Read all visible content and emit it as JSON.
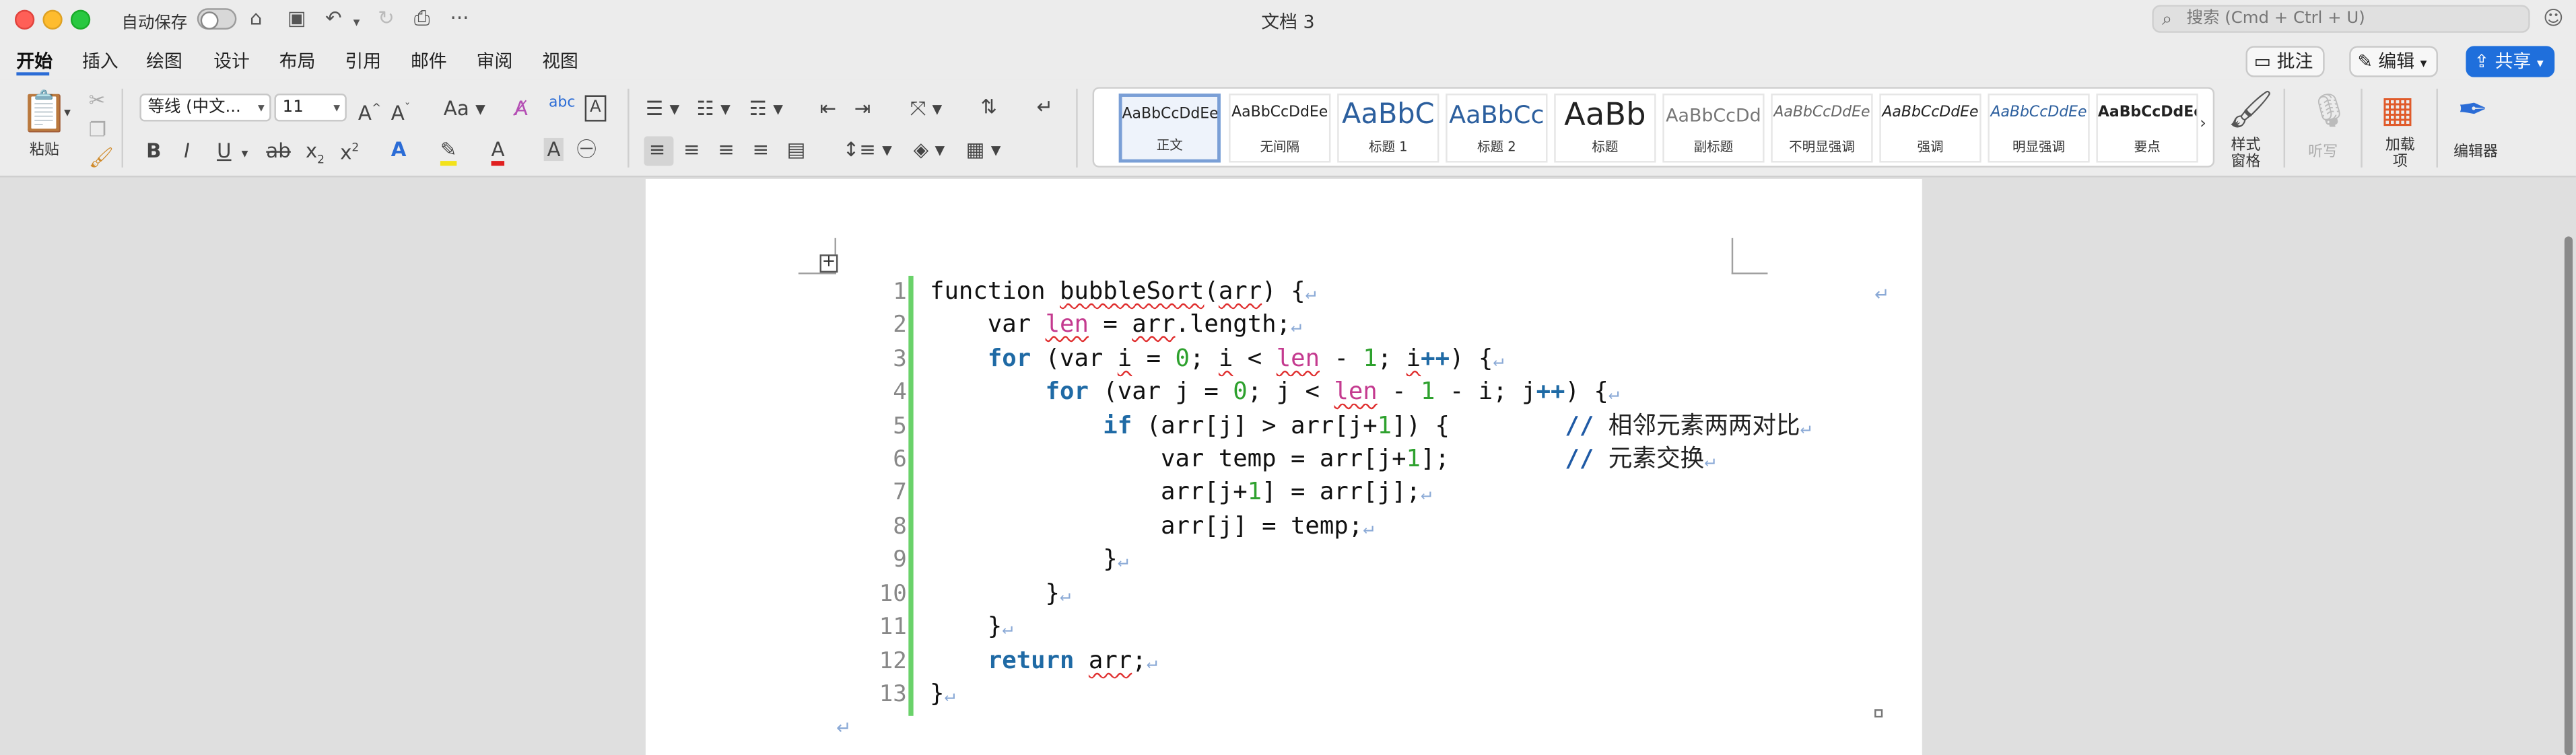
{
  "window": {
    "doc_title": "文档 3",
    "autosave_label": "自动保存",
    "search_placeholder": "搜索 (Cmd + Ctrl + U)"
  },
  "ribbon_tabs": [
    "开始",
    "插入",
    "绘图",
    "设计",
    "布局",
    "引用",
    "邮件",
    "审阅",
    "视图"
  ],
  "ribbon_buttons": {
    "comment": "批注",
    "edit": "编辑",
    "share": "共享"
  },
  "home": {
    "paste_label": "粘贴",
    "font_name": "等线 (中文...",
    "font_size": "11",
    "styles_pane": "样式\n窗格",
    "dictate": "听写",
    "addins": "加载\n项",
    "editor": "编辑器"
  },
  "styles": [
    {
      "sample": "AaBbCcDdEe",
      "name": "正文"
    },
    {
      "sample": "AaBbCcDdEe",
      "name": "无间隔"
    },
    {
      "sample": "AaBbC",
      "name": "标题 1"
    },
    {
      "sample": "AaBbCc",
      "name": "标题 2"
    },
    {
      "sample": "AaBb",
      "name": "标题"
    },
    {
      "sample": "AaBbCcDd",
      "name": "副标题"
    },
    {
      "sample": "AaBbCcDdEe",
      "name": "不明显强调"
    },
    {
      "sample": "AaBbCcDdEe",
      "name": "强调"
    },
    {
      "sample": "AaBbCcDdEe",
      "name": "明显强调"
    },
    {
      "sample": "AaBbCcDdEe",
      "name": "要点"
    }
  ],
  "code": {
    "line_numbers": [
      "1",
      "2",
      "3",
      "4",
      "5",
      "6",
      "7",
      "8",
      "9",
      "10",
      "11",
      "12",
      "13"
    ],
    "comments": [
      "相邻元素两两对比",
      "元素交换"
    ]
  },
  "colors": {
    "share": "#1f6fdc",
    "code_bar": "#6ad26a",
    "keyword": "#1f6aa5",
    "number": "#2ea12e",
    "identifier": "#c43a8f"
  }
}
